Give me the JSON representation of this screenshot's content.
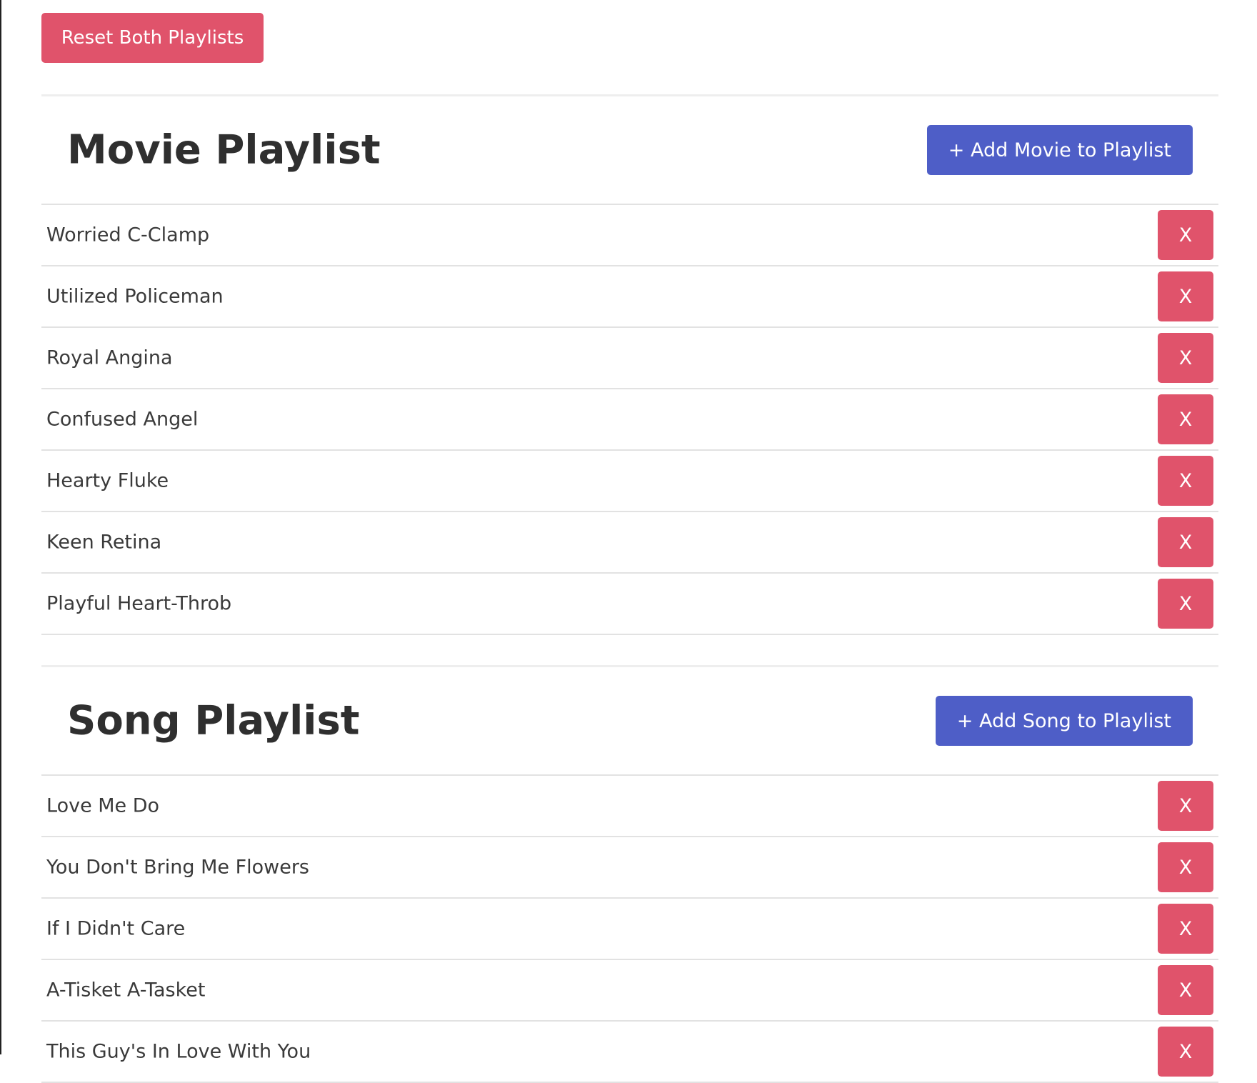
{
  "reset_button": {
    "label": "Reset Both Playlists"
  },
  "colors": {
    "danger": "#e0536b",
    "primary": "#4e5ec7",
    "text": "#333333",
    "divider": "#e2e2e2"
  },
  "remove_button_label": "X",
  "movie_playlist": {
    "title": "Movie Playlist",
    "add_button_label": "+ Add Movie to Playlist",
    "items": [
      "Worried C-Clamp",
      "Utilized Policeman",
      "Royal Angina",
      "Confused Angel",
      "Hearty Fluke",
      "Keen Retina",
      "Playful Heart-Throb"
    ]
  },
  "song_playlist": {
    "title": "Song Playlist",
    "add_button_label": "+ Add Song to Playlist",
    "items": [
      "Love Me Do",
      "You Don't Bring Me Flowers",
      "If I Didn't Care",
      "A-Tisket A-Tasket",
      "This Guy's In Love With You"
    ]
  }
}
